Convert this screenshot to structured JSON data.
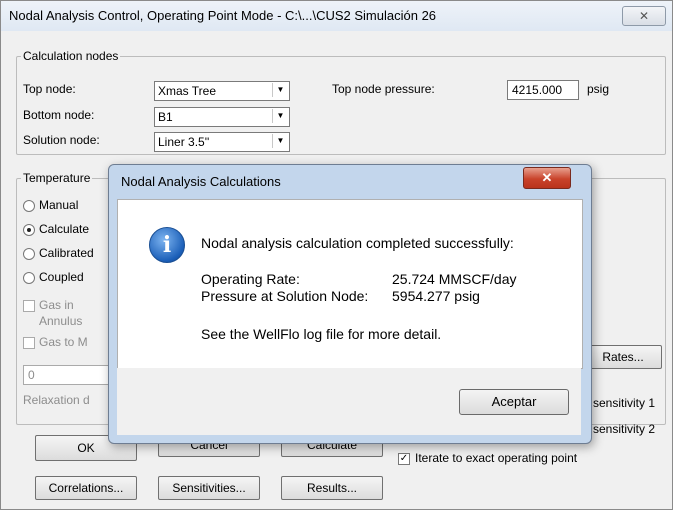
{
  "window": {
    "title": "Nodal Analysis Control, Operating Point Mode - C:\\...\\CUS2 Simulación 26",
    "close_label": "✕"
  },
  "calc_nodes": {
    "legend": "Calculation nodes",
    "top_node_label": "Top node:",
    "top_node_value": "Xmas Tree",
    "bottom_node_label": "Bottom node:",
    "bottom_node_value": "B1",
    "solution_node_label": "Solution node:",
    "solution_node_value": "Liner 3.5''",
    "top_pressure_label": "Top node pressure:",
    "top_pressure_value": "4215.000",
    "top_pressure_unit": "psig"
  },
  "temperature": {
    "legend": "Temperature",
    "options": [
      "Manual",
      "Calculate",
      "Calibrated",
      "Coupled"
    ],
    "selected": "Calculate",
    "gas_in_annulus_1": "Gas in",
    "gas_in_annulus_2": "Annulus",
    "gas_to_m": "Gas to M",
    "value_field": "0",
    "relaxation_label": "Relaxation d"
  },
  "right_panel": {
    "rates_button": "Rates...",
    "sensitivity_1": "sensitivity 1",
    "sensitivity_2": "sensitivity 2",
    "iterate_label": "Iterate to exact operating point"
  },
  "buttons": {
    "ok": "OK",
    "cancel": "Cancel",
    "calculate": "Calculate",
    "correlations": "Correlations...",
    "sensitivities": "Sensitivities...",
    "results": "Results..."
  },
  "dialog": {
    "title": "Nodal Analysis Calculations",
    "close_label": "✕",
    "message": "Nodal analysis calculation completed successfully:",
    "rate_label": "Operating Rate:",
    "rate_value": "25.724 MMSCF/day",
    "pressure_label": "Pressure at Solution Node:",
    "pressure_value": "5954.277 psig",
    "log_note": "See the WellFlo log file for more detail.",
    "accept_button": "Aceptar",
    "info_glyph": "i"
  }
}
